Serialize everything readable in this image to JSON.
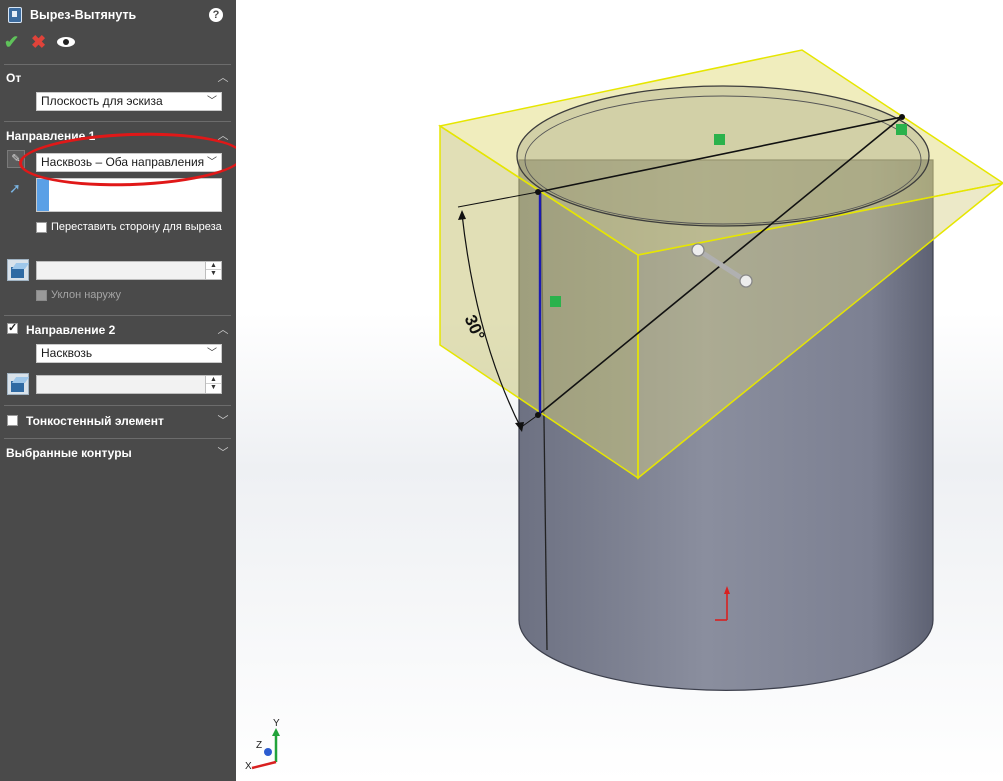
{
  "panel": {
    "title": "Вырез-Вытянуть",
    "icons": {
      "feature": "cut-extrude-icon",
      "help": "help-icon",
      "ok": "checkmark-icon",
      "cancel": "close-icon",
      "preview": "eye-icon"
    },
    "help_glyph": "?",
    "from": {
      "header": "От",
      "dropdown_value": "Плоскость для эскиза"
    },
    "direction1": {
      "header": "Направление 1",
      "end_condition": "Насквозь – Оба направления",
      "flip_side_label": "Переставить сторону для выреза",
      "draft_outward_label": "Уклон наружу",
      "flip_side_checked": false,
      "draft_outward_enabled": false
    },
    "direction2": {
      "header": "Направление 2",
      "checked": true,
      "end_condition": "Насквозь"
    },
    "thin_feature": {
      "header": "Тонкостенный элемент",
      "checked": false
    },
    "selected_contours": {
      "header": "Выбранные контуры"
    }
  },
  "viewport": {
    "angle_dimension": "30°",
    "triad": {
      "y": "Y",
      "z": "Z",
      "x": "X"
    }
  },
  "colors": {
    "panel_bg": "#4a4a4a",
    "annotation_red": "#e01818",
    "preview_fill": "#d8d36a",
    "preview_edge": "#e6e600",
    "cylinder": "#7d8191",
    "sketch_line": "#1b1bb0",
    "relation_green": "#2bb24c"
  }
}
